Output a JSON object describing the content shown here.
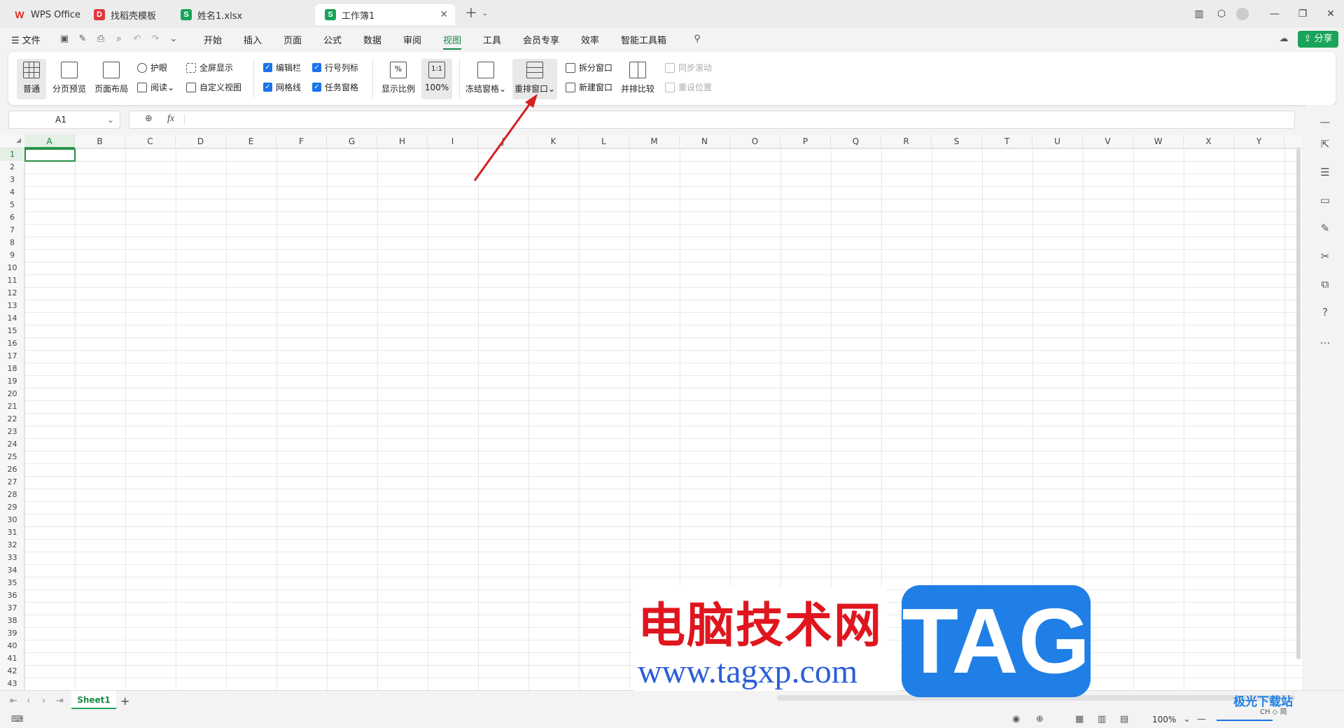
{
  "tabs": [
    {
      "label": "WPS Office",
      "icon": "wps-logo-icon",
      "color": "#d93025"
    },
    {
      "label": "找稻壳模板",
      "icon": "docer-icon",
      "color": "#e0383e"
    },
    {
      "label": "姓名1.xlsx",
      "icon": "spreadsheet-icon",
      "color": "#1aa35a"
    },
    {
      "label": "工作簿1",
      "icon": "spreadsheet-icon",
      "color": "#1aa35a"
    }
  ],
  "menu": {
    "file": "文件",
    "items": [
      "开始",
      "插入",
      "页面",
      "公式",
      "数据",
      "审阅",
      "视图",
      "工具",
      "会员专享",
      "效率",
      "智能工具箱"
    ],
    "active": "视图",
    "share": "分享"
  },
  "ribbon": {
    "normal": "普通",
    "page_break": "分页预览",
    "page_layout": "页面布局",
    "eye_care": "护眼",
    "reading": "阅读",
    "fullscreen": "全屏显示",
    "custom_view": "自定义视图",
    "formula_bar": "编辑栏",
    "headings": "行号列标",
    "gridlines": "网格线",
    "task_pane": "任务窗格",
    "zoom": "显示比例",
    "zoom100_icon": "1:1",
    "zoom100": "100%",
    "freeze": "冻结窗格",
    "arrange": "重排窗口",
    "split": "拆分窗口",
    "new_window": "新建窗口",
    "side_by_side": "并排比较",
    "sync_scroll": "同步滚动",
    "reset_pos": "重设位置"
  },
  "formula": {
    "name_box": "A1",
    "fx": "fx"
  },
  "columns": [
    "A",
    "B",
    "C",
    "D",
    "E",
    "F",
    "G",
    "H",
    "I",
    "J",
    "K",
    "L",
    "M",
    "N",
    "O",
    "P",
    "Q",
    "R",
    "S",
    "T",
    "U",
    "V",
    "W",
    "X",
    "Y"
  ],
  "rows": [
    "1",
    "2",
    "3",
    "4",
    "5",
    "6",
    "7",
    "8",
    "9",
    "10",
    "11",
    "12",
    "13",
    "14",
    "15",
    "16",
    "17",
    "18",
    "19",
    "20",
    "21",
    "22",
    "23",
    "24",
    "25",
    "26",
    "27",
    "28",
    "29",
    "30",
    "31",
    "32",
    "33",
    "34",
    "35",
    "36",
    "37",
    "38",
    "39",
    "40",
    "41",
    "42",
    "43"
  ],
  "sheets": {
    "active": "Sheet1",
    "add": "+"
  },
  "status": {
    "zoom": "100%"
  },
  "watermark": {
    "line1": "电脑技术网",
    "line2": "www.tagxp.com",
    "tag": "TAG",
    "brand": "极光下载站",
    "brand_sub": "CH ◇ 简"
  },
  "colors": {
    "accent": "#1aa35a",
    "checkbox": "#1a73e8",
    "arrow": "#d42020"
  }
}
